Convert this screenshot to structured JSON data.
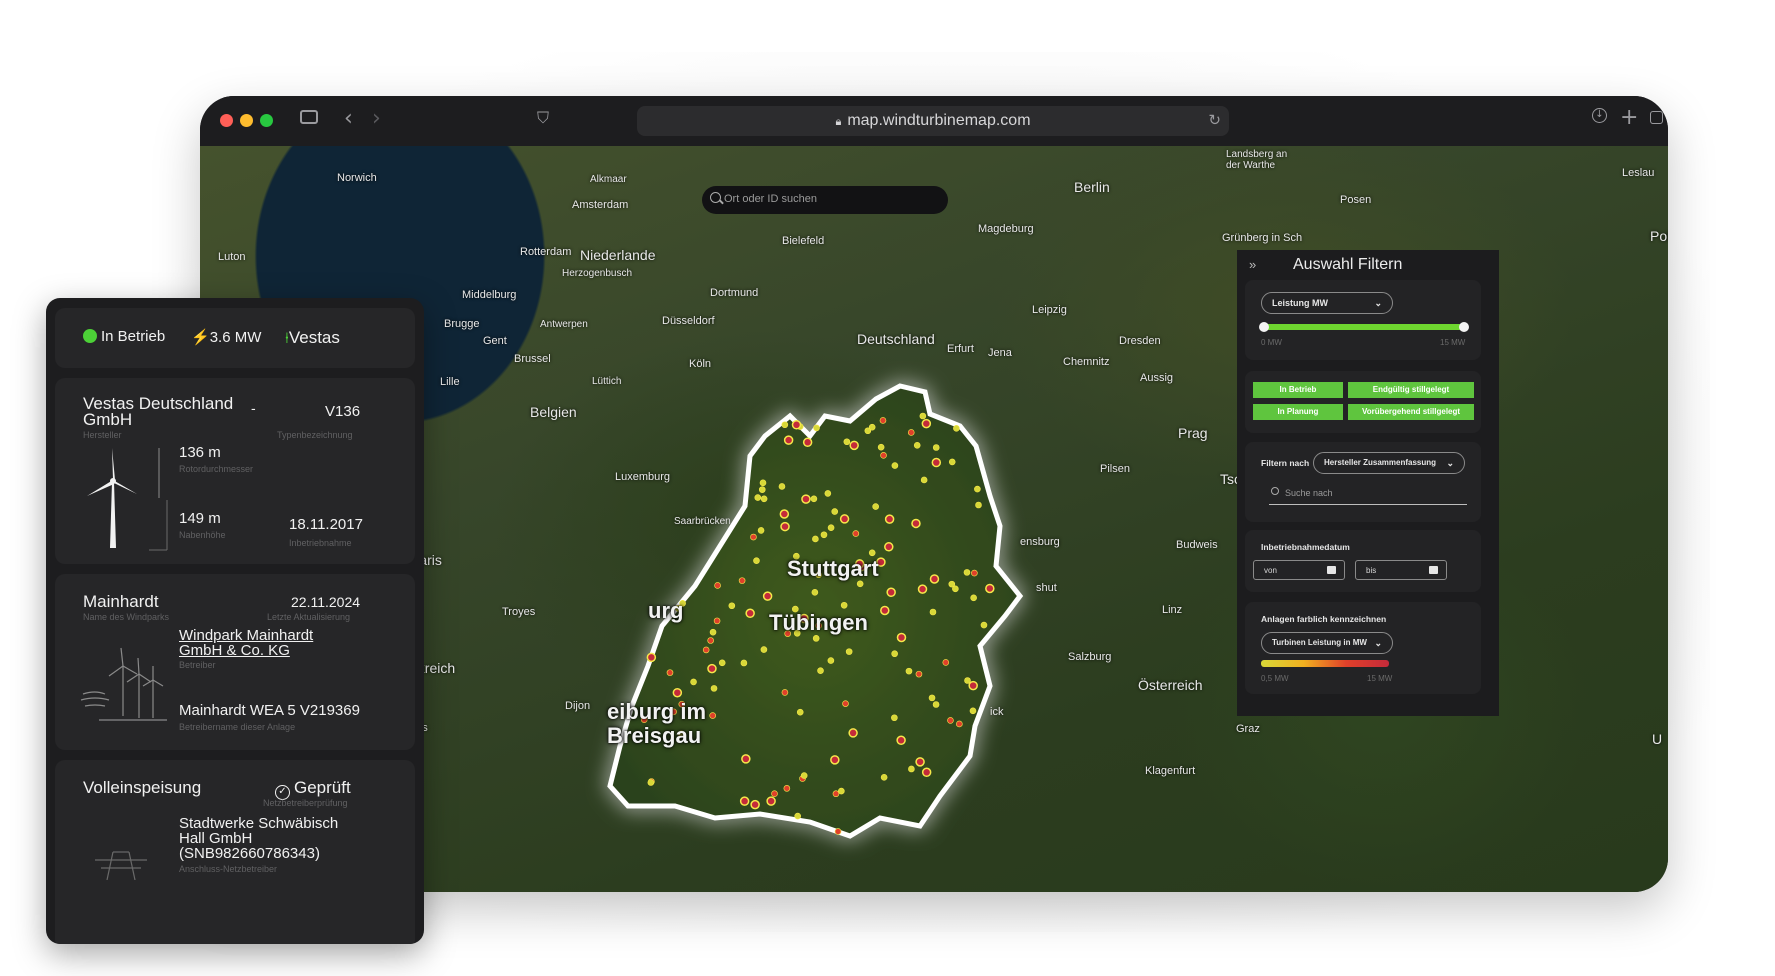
{
  "browser": {
    "url": "map.windturbinemap.com"
  },
  "search": {
    "placeholder": "Ort oder ID suchen"
  },
  "map_labels": {
    "norwich": "Norwich",
    "alkmaar": "Alkmaar",
    "amsterdam": "Amsterdam",
    "luton": "Luton",
    "rotterdam": "Rotterdam",
    "niederlande": "Niederlande",
    "herzogenbusch": "Herzogenbusch",
    "middelburg": "Middelburg",
    "brugge": "Brugge",
    "antwerpen": "Antwerpen",
    "gent": "Gent",
    "brussel": "Brussel",
    "lille": "Lille",
    "luettich": "Lüttich",
    "belgien": "Belgien",
    "luxemburg": "Luxemburg",
    "saarbruecken": "Saarbrücken",
    "paris": "Paris",
    "troyes": "Troyes",
    "dijon": "Dijon",
    "frankreich_fragment": "nkreich",
    "ges_fragment": "ges",
    "bielefeld": "Bielefeld",
    "dortmund": "Dortmund",
    "duesseldorf": "Düsseldorf",
    "koeln": "Köln",
    "deutschland": "Deutschland",
    "erfurt": "Erfurt",
    "jena": "Jena",
    "leipzig": "Leipzig",
    "dresden": "Dresden",
    "chemnitz": "Chemnitz",
    "magdeburg": "Magdeburg",
    "berlin": "Berlin",
    "landsberg": "Landsberg an der Warthe",
    "leslau": "Leslau",
    "posen": "Posen",
    "gruenberg": "Grünberg in Sch",
    "pol_fragment": "Pol",
    "aussig": "Aussig",
    "prag": "Prag",
    "pilsen": "Pilsen",
    "tsche_fragment": "Tsche",
    "budweis": "Budweis",
    "burg_fragment": "ensburg",
    "shut_fragment": "shut",
    "linz": "Linz",
    "salzburg": "Salzburg",
    "oesterreich": "Österreich",
    "graz": "Graz",
    "klagenfurt": "Klagenfurt",
    "ick_fragment": "ick",
    "u_fragment": "U",
    "stuttgart": "Stuttgart",
    "tuebingen": "Tübingen",
    "freiburg": "eiburg im Breisgau",
    "burg_left": "urg"
  },
  "filter": {
    "title": "Auswahl Filtern",
    "power_select": "Leistung MW",
    "power_min": "0 MW",
    "power_max": "15 MW",
    "status_buttons": [
      "In Betrieb",
      "Endgültig stillgelegt",
      "In Planung",
      "Vorübergehend stillgelegt"
    ],
    "filter_by_label": "Filtern nach",
    "filter_by_value": "Hersteller Zusammenfassung",
    "search_placeholder": "Suche nach",
    "date_label": "Inbetriebnahmedatum",
    "date_from": "von",
    "date_to": "bis",
    "color_label": "Anlagen farblich kennzeichnen",
    "color_select": "Turbinen Leistung in MW",
    "color_min": "0,5 MW",
    "color_max": "15 MW",
    "colors": {
      "accent": "#5fc53e",
      "scale": [
        "#d8d838",
        "#f1b020",
        "#e0402a",
        "#c42a3a"
      ]
    }
  },
  "turbine_panel": {
    "summary": {
      "status": "In Betrieb",
      "power": "3.6 MW",
      "manufacturer": "Vestas"
    },
    "manufacturer": {
      "name": "Vestas Deutschland GmbH",
      "dash": "-",
      "name_label": "Hersteller",
      "type": "V136",
      "type_label": "Typenbezeichnung"
    },
    "rotor": {
      "value": "136 m",
      "label": "Rotordurchmesser"
    },
    "hub": {
      "value": "149 m",
      "label": "Nabenhöhe"
    },
    "commissioning": {
      "value": "18.11.2017",
      "label": "Inbetriebnahme"
    },
    "park": {
      "name": "Mainhardt",
      "name_label": "Name des Windparks",
      "updated": "22.11.2024",
      "updated_label": "Letzte Aktualisierung",
      "operator": "Windpark Mainhardt GmbH & Co. KG",
      "operator_label": "Betreiber",
      "plant": "Mainhardt WEA 5 V219369",
      "plant_label": "Betreibername dieser Anlage"
    },
    "grid": {
      "feed": "Volleinspeisung",
      "check": "Geprüft",
      "check_label": "Netzbetreiberprüfung",
      "operator": "Stadtwerke Schwäbisch Hall GmbH (SNB982660786343)",
      "operator_label": "Anschluss-Netzbetreiber"
    }
  }
}
